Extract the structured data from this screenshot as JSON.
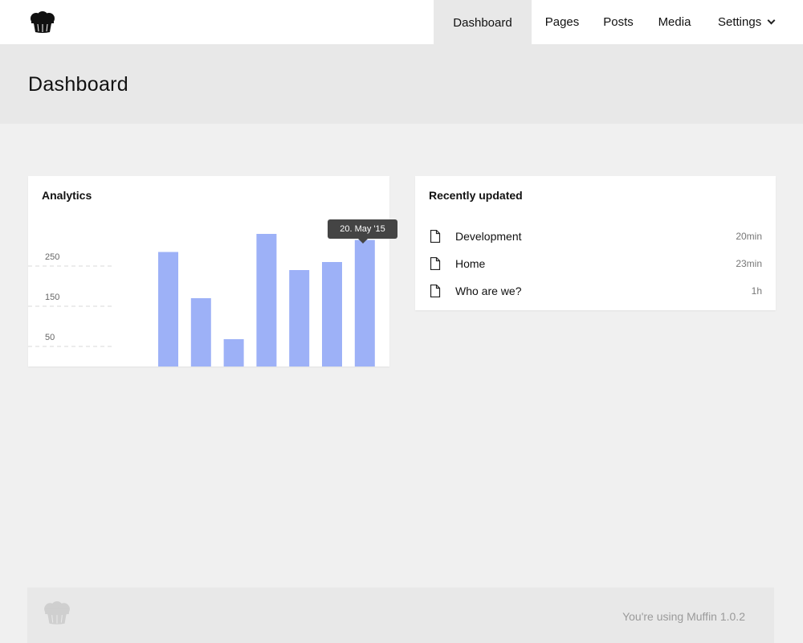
{
  "nav": {
    "items": [
      {
        "label": "Dashboard",
        "active": true
      },
      {
        "label": "Pages"
      },
      {
        "label": "Posts"
      },
      {
        "label": "Media"
      },
      {
        "label": "Settings",
        "has_dropdown": true
      }
    ]
  },
  "header": {
    "title": "Dashboard"
  },
  "analytics": {
    "title": "Analytics",
    "tooltip": "20. May '15"
  },
  "chart_data": {
    "type": "bar",
    "values": [
      285,
      170,
      68,
      330,
      240,
      260,
      315
    ],
    "y_ticks": [
      250,
      150,
      50
    ],
    "ylim": [
      0,
      330
    ],
    "bar_color": "#9db1f7",
    "grid": "dashed",
    "highlighted_index": 6
  },
  "recent": {
    "title": "Recently updated",
    "items": [
      {
        "name": "Development",
        "time": "20min",
        "icon": "document-icon"
      },
      {
        "name": "Home",
        "time": "23min",
        "icon": "document-icon"
      },
      {
        "name": "Who are we?",
        "time": "1h",
        "icon": "document-icon"
      }
    ]
  },
  "footer": {
    "text": "You're using Muffin 1.0.2"
  },
  "colors": {
    "accent_bar": "#9db1f7",
    "tooltip_bg": "#444444",
    "page_bg": "#f0f0f0",
    "header_bg": "#e8e8e8"
  }
}
